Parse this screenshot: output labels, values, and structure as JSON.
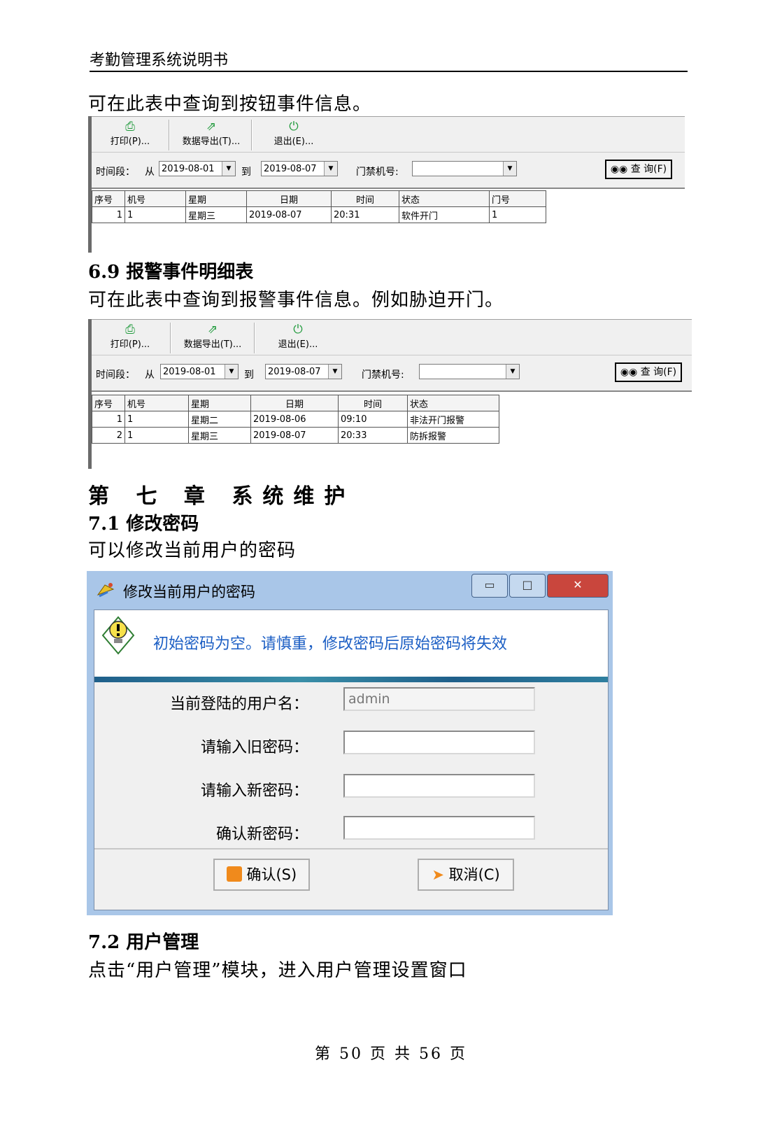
{
  "header": {
    "title": "考勤管理系统说明书"
  },
  "intro_button": "可在此表中查询到按钮事件信息。",
  "report_common": {
    "print": "打印(P)...",
    "export": "数据导出(T)...",
    "exit": "退出(E)...",
    "time_label": "时间段：",
    "from": "从",
    "to": "到",
    "door_no_label": "门禁机号:",
    "query": "查 询(F)"
  },
  "report1": {
    "date_from": "2019-08-01",
    "date_to": "2019-08-07",
    "door_no": "",
    "columns": [
      "序号",
      "机号",
      "星期",
      "日期",
      "时间",
      "状态",
      "门号"
    ],
    "rows": [
      [
        "1",
        "1",
        "星期三",
        "2019-08-07",
        "20:31",
        "软件开门",
        "1"
      ]
    ]
  },
  "section_6_9": {
    "heading": "6.9  报警事件明细表",
    "text": "可在此表中查询到报警事件信息。例如胁迫开门。"
  },
  "report2": {
    "date_from": "2019-08-01",
    "date_to": "2019-08-07",
    "door_no": "",
    "columns": [
      "序号",
      "机号",
      "星期",
      "日期",
      "时间",
      "状态"
    ],
    "rows": [
      [
        "1",
        "1",
        "星期二",
        "2019-08-06",
        "09:10",
        "非法开门报警"
      ],
      [
        "2",
        "1",
        "星期三",
        "2019-08-07",
        "20:33",
        "防拆报警"
      ]
    ]
  },
  "chapter7": {
    "title": "第 七 章 系统维护"
  },
  "section_7_1": {
    "heading": "7.1  修改密码",
    "text": "可以修改当前用户的密码"
  },
  "dialog": {
    "title": "修改当前用户的密码",
    "warning": "初始密码为空。请慎重，修改密码后原始密码将失效",
    "username_label": "当前登陆的用户名：",
    "username_value": "admin",
    "old_pwd_label": "请输入旧密码：",
    "new_pwd_label": "请输入新密码：",
    "confirm_pwd_label": "确认新密码：",
    "ok": "确认(S)",
    "cancel": "取消(C)",
    "minimize_glyph": "▭",
    "maximize_glyph": "□",
    "close_glyph": "✕"
  },
  "section_7_2": {
    "heading": "7.2  用户管理",
    "text": "点击“用户管理”模块，进入用户管理设置窗口"
  },
  "footer": {
    "page": "第 50 页 共 56 页"
  },
  "icons": {
    "print": "printer-icon",
    "export": "export-icon",
    "exit": "power-icon",
    "query": "binoculars-icon",
    "dialog_app": "key-icon",
    "warning": "lightbulb-warning-icon",
    "ok": "floppy-icon",
    "cancel": "cursor-icon"
  },
  "colors": {
    "toolbar_icon": "#1f9a3b",
    "warning_text": "#1b5ec4",
    "title_bar": "#a9c6e8",
    "close_button": "#c9463d"
  }
}
